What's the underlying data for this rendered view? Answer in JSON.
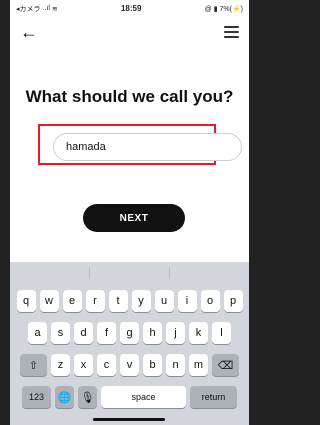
{
  "status": {
    "carrier": "◂カメラ",
    "signal": "..ıl",
    "wifi": "≋",
    "time": "18:59",
    "right": "@ ▮ 7%(⚡)"
  },
  "nav": {
    "back": "←"
  },
  "title": "What should we call you?",
  "name_input": {
    "value": "hamada",
    "highlight_color": "#e01e2a"
  },
  "next_label": "NEXT",
  "keyboard": {
    "row1": [
      "q",
      "w",
      "e",
      "r",
      "t",
      "y",
      "u",
      "i",
      "o",
      "p"
    ],
    "row2": [
      "a",
      "s",
      "d",
      "f",
      "g",
      "h",
      "j",
      "k",
      "l"
    ],
    "row3": [
      "z",
      "x",
      "c",
      "v",
      "b",
      "n",
      "m"
    ],
    "shift": "⇧",
    "delete": "⌫",
    "numbers": "123",
    "globe": "🌐",
    "mic": "🎙",
    "space": "space",
    "return": "return"
  }
}
